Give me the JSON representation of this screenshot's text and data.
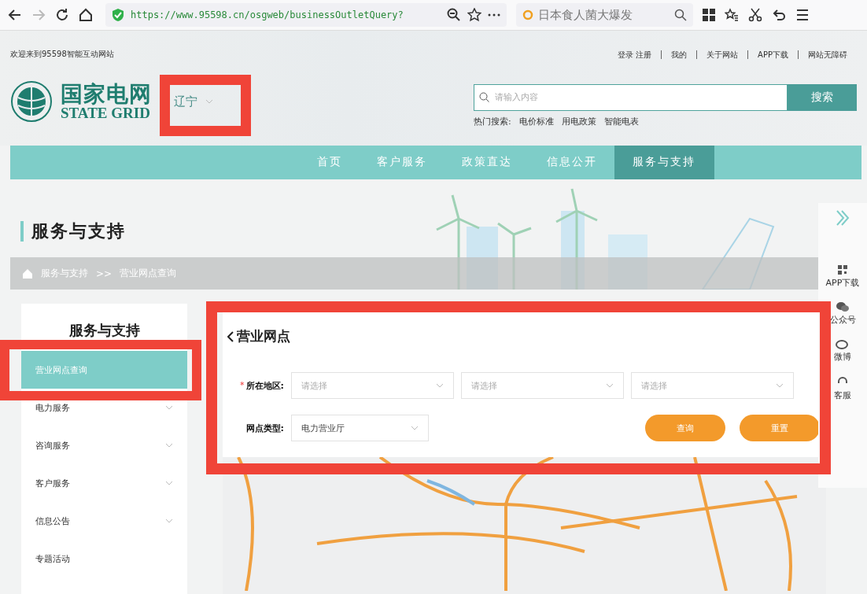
{
  "browser": {
    "url": "https://www.95598.cn/osgweb/businessOutletQuery?",
    "search_value": "日本食人菌大爆发",
    "forward_disabled": true
  },
  "header": {
    "welcome": "欢迎来到95598智能互动网站",
    "links": [
      "登录 注册",
      "我的",
      "关于网站",
      "APP下载",
      "网站无障碍"
    ],
    "logo": {
      "name_cn": "国家电网",
      "name_en": "STATE GRID"
    },
    "region": "辽宁",
    "search": {
      "placeholder": "请输入内容",
      "button": "搜索"
    },
    "hot_label": "热门搜索:",
    "hot_items": [
      "电价标准",
      "用电政策",
      "智能电表"
    ]
  },
  "nav": {
    "items": [
      {
        "label": "首页",
        "selected": false
      },
      {
        "label": "客户服务",
        "selected": false
      },
      {
        "label": "政策直达",
        "selected": false
      },
      {
        "label": "信息公开",
        "selected": false
      },
      {
        "label": "服务与支持",
        "selected": true
      }
    ]
  },
  "banner": {
    "title": "服务与支持",
    "breadcrumb": [
      "服务与支持",
      "营业网点查询"
    ],
    "separator": ">>"
  },
  "sidebar": {
    "title": "服务与支持",
    "items": [
      {
        "label": "营业网点查询",
        "selected": true,
        "expandable": false
      },
      {
        "label": "电力服务",
        "selected": false,
        "expandable": true
      },
      {
        "label": "咨询服务",
        "selected": false,
        "expandable": true
      },
      {
        "label": "客户服务",
        "selected": false,
        "expandable": true
      },
      {
        "label": "信息公告",
        "selected": false,
        "expandable": true
      },
      {
        "label": "专题活动",
        "selected": false,
        "expandable": false
      }
    ]
  },
  "panel": {
    "title": "营业网点",
    "required_mark": "*",
    "region_label": "所在地区:",
    "region_selects": [
      {
        "placeholder": "请选择"
      },
      {
        "placeholder": "请选择"
      },
      {
        "placeholder": "请选择"
      }
    ],
    "type_label": "网点类型:",
    "type_value": "电力营业厅",
    "buttons": [
      {
        "label": "查询"
      },
      {
        "label": "重置"
      }
    ]
  },
  "float_bar": {
    "items": [
      {
        "kind": "expand"
      },
      {
        "kind": "qr",
        "label": "APP下载"
      },
      {
        "kind": "wechat",
        "label": "公众号"
      },
      {
        "kind": "weibo",
        "label": "微博"
      },
      {
        "kind": "service",
        "label": "客服"
      }
    ]
  }
}
